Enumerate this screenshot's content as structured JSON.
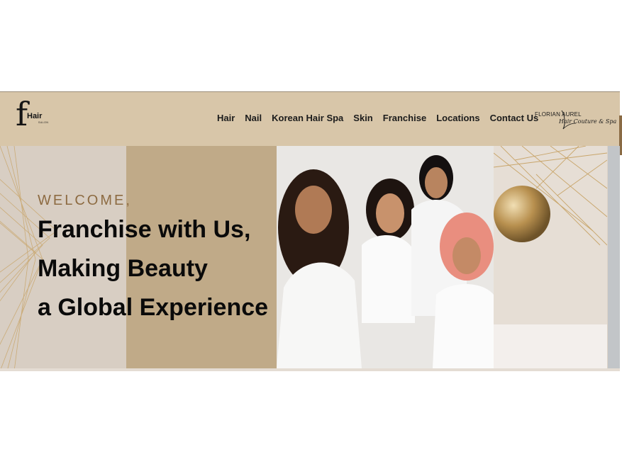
{
  "header": {
    "logo": {
      "initial": "f",
      "word": "Hair",
      "sub": "SALON"
    },
    "nav": [
      "Hair",
      "Nail",
      "Korean Hair Spa",
      "Skin",
      "Franchise",
      "Locations",
      "Contact Us"
    ],
    "partner": {
      "brand": "FLORIAN AUREL",
      "tagline": "Hair Couture & Spa"
    }
  },
  "hero": {
    "welcome": "WELCOME,",
    "lines": [
      "Franchise with Us,",
      "Making Beauty",
      "a Global Experience"
    ],
    "image": "models-in-white-photo"
  },
  "colors": {
    "header_bg": "#d8c6a9",
    "block": "#c0aa88",
    "accent_text": "#8d6b42"
  }
}
